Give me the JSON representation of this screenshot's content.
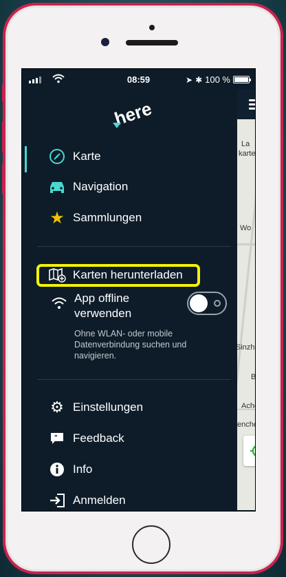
{
  "status_bar": {
    "time": "08:59",
    "battery": "100 %"
  },
  "brand": {
    "logo": "here"
  },
  "menu": {
    "karte": "Karte",
    "navigation": "Navigation",
    "sammlungen": "Sammlungen",
    "karten_herunterladen": "Karten herunterladen",
    "offline_label_line1": "App offline",
    "offline_label_line2": "verwenden",
    "offline_desc": "Ohne WLAN- oder mobile Datenverbindung suchen und navigieren.",
    "offline_enabled": false,
    "einstellungen": "Einstellungen",
    "feedback": "Feedback",
    "info": "Info",
    "anmelden": "Anmelden"
  },
  "map": {
    "labels": [
      "La",
      "karte",
      "Wo",
      "Sinzheim",
      "B",
      "Achern",
      "enchen"
    ]
  },
  "colors": {
    "drawer_bg": "#0e1c29",
    "accent": "#48dad0",
    "highlight": "#f4f205",
    "phone_frame": "#c9234f"
  }
}
